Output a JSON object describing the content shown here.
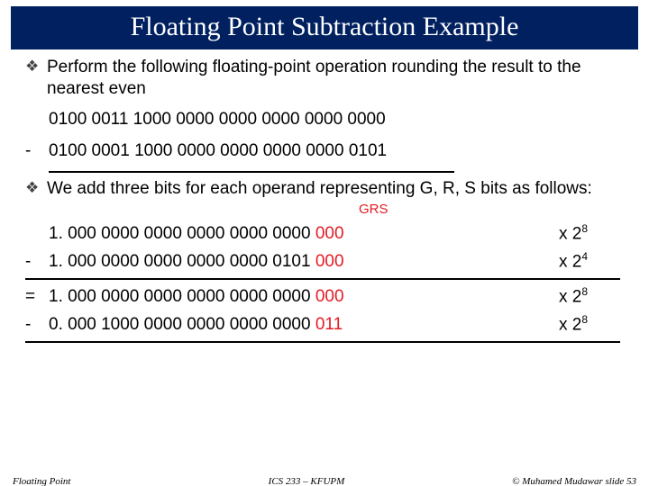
{
  "title": "Floating Point Subtraction Example",
  "bullet1": "Perform the following floating-point operation rounding the result to the nearest even",
  "operand1": "0100 0011 1000 0000 0000 0000 0000 0000",
  "operand2": "0100 0001 1000 0000 0000 0000 0000 0101",
  "bullet2": "We add three bits for each operand representing G, R, S bits as follows:",
  "grs_label": "GRS",
  "calc": [
    {
      "op": "",
      "mant": "1. 000 0000 0000 0000 0000 0000",
      "grs": " 000",
      "exp_base": "x  2",
      "exp_sup": "8"
    },
    {
      "op": "-",
      "mant": "1. 000 0000 0000 0000 0000 0101",
      "grs": " 000",
      "exp_base": "x  2",
      "exp_sup": "4"
    },
    {
      "op": "=",
      "mant": "1. 000 0000 0000 0000 0000 0000",
      "grs": " 000",
      "exp_base": "x  2",
      "exp_sup": "8"
    },
    {
      "op": "-",
      "mant": "0. 000 1000 0000 0000 0000 0000",
      "grs": " 011",
      "exp_base": "x  2",
      "exp_sup": "8"
    }
  ],
  "footer": {
    "left": "Floating Point",
    "center": "ICS 233 – KFUPM",
    "right": "© Muhamed Mudawar   slide 53"
  }
}
